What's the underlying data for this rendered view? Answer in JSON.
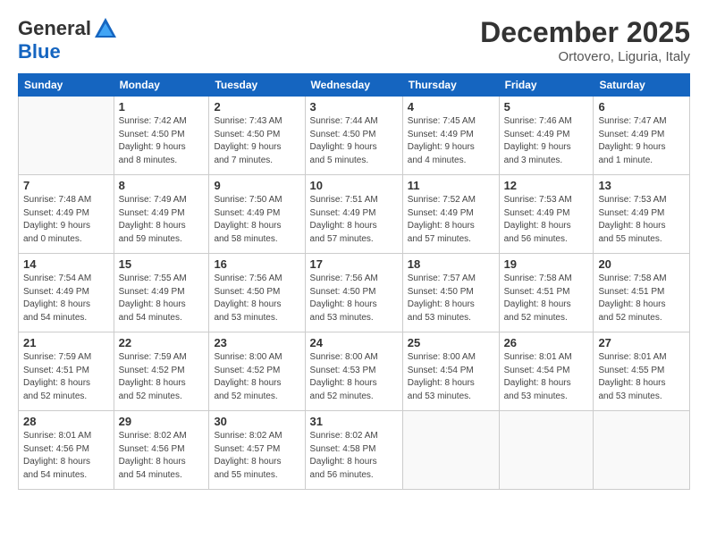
{
  "header": {
    "logo_general": "General",
    "logo_blue": "Blue",
    "month": "December 2025",
    "location": "Ortovero, Liguria, Italy"
  },
  "days_of_week": [
    "Sunday",
    "Monday",
    "Tuesday",
    "Wednesday",
    "Thursday",
    "Friday",
    "Saturday"
  ],
  "weeks": [
    [
      {
        "day": "",
        "info": ""
      },
      {
        "day": "1",
        "info": "Sunrise: 7:42 AM\nSunset: 4:50 PM\nDaylight: 9 hours\nand 8 minutes."
      },
      {
        "day": "2",
        "info": "Sunrise: 7:43 AM\nSunset: 4:50 PM\nDaylight: 9 hours\nand 7 minutes."
      },
      {
        "day": "3",
        "info": "Sunrise: 7:44 AM\nSunset: 4:50 PM\nDaylight: 9 hours\nand 5 minutes."
      },
      {
        "day": "4",
        "info": "Sunrise: 7:45 AM\nSunset: 4:49 PM\nDaylight: 9 hours\nand 4 minutes."
      },
      {
        "day": "5",
        "info": "Sunrise: 7:46 AM\nSunset: 4:49 PM\nDaylight: 9 hours\nand 3 minutes."
      },
      {
        "day": "6",
        "info": "Sunrise: 7:47 AM\nSunset: 4:49 PM\nDaylight: 9 hours\nand 1 minute."
      }
    ],
    [
      {
        "day": "7",
        "info": "Sunrise: 7:48 AM\nSunset: 4:49 PM\nDaylight: 9 hours\nand 0 minutes."
      },
      {
        "day": "8",
        "info": "Sunrise: 7:49 AM\nSunset: 4:49 PM\nDaylight: 8 hours\nand 59 minutes."
      },
      {
        "day": "9",
        "info": "Sunrise: 7:50 AM\nSunset: 4:49 PM\nDaylight: 8 hours\nand 58 minutes."
      },
      {
        "day": "10",
        "info": "Sunrise: 7:51 AM\nSunset: 4:49 PM\nDaylight: 8 hours\nand 57 minutes."
      },
      {
        "day": "11",
        "info": "Sunrise: 7:52 AM\nSunset: 4:49 PM\nDaylight: 8 hours\nand 57 minutes."
      },
      {
        "day": "12",
        "info": "Sunrise: 7:53 AM\nSunset: 4:49 PM\nDaylight: 8 hours\nand 56 minutes."
      },
      {
        "day": "13",
        "info": "Sunrise: 7:53 AM\nSunset: 4:49 PM\nDaylight: 8 hours\nand 55 minutes."
      }
    ],
    [
      {
        "day": "14",
        "info": "Sunrise: 7:54 AM\nSunset: 4:49 PM\nDaylight: 8 hours\nand 54 minutes."
      },
      {
        "day": "15",
        "info": "Sunrise: 7:55 AM\nSunset: 4:49 PM\nDaylight: 8 hours\nand 54 minutes."
      },
      {
        "day": "16",
        "info": "Sunrise: 7:56 AM\nSunset: 4:50 PM\nDaylight: 8 hours\nand 53 minutes."
      },
      {
        "day": "17",
        "info": "Sunrise: 7:56 AM\nSunset: 4:50 PM\nDaylight: 8 hours\nand 53 minutes."
      },
      {
        "day": "18",
        "info": "Sunrise: 7:57 AM\nSunset: 4:50 PM\nDaylight: 8 hours\nand 53 minutes."
      },
      {
        "day": "19",
        "info": "Sunrise: 7:58 AM\nSunset: 4:51 PM\nDaylight: 8 hours\nand 52 minutes."
      },
      {
        "day": "20",
        "info": "Sunrise: 7:58 AM\nSunset: 4:51 PM\nDaylight: 8 hours\nand 52 minutes."
      }
    ],
    [
      {
        "day": "21",
        "info": "Sunrise: 7:59 AM\nSunset: 4:51 PM\nDaylight: 8 hours\nand 52 minutes."
      },
      {
        "day": "22",
        "info": "Sunrise: 7:59 AM\nSunset: 4:52 PM\nDaylight: 8 hours\nand 52 minutes."
      },
      {
        "day": "23",
        "info": "Sunrise: 8:00 AM\nSunset: 4:52 PM\nDaylight: 8 hours\nand 52 minutes."
      },
      {
        "day": "24",
        "info": "Sunrise: 8:00 AM\nSunset: 4:53 PM\nDaylight: 8 hours\nand 52 minutes."
      },
      {
        "day": "25",
        "info": "Sunrise: 8:00 AM\nSunset: 4:54 PM\nDaylight: 8 hours\nand 53 minutes."
      },
      {
        "day": "26",
        "info": "Sunrise: 8:01 AM\nSunset: 4:54 PM\nDaylight: 8 hours\nand 53 minutes."
      },
      {
        "day": "27",
        "info": "Sunrise: 8:01 AM\nSunset: 4:55 PM\nDaylight: 8 hours\nand 53 minutes."
      }
    ],
    [
      {
        "day": "28",
        "info": "Sunrise: 8:01 AM\nSunset: 4:56 PM\nDaylight: 8 hours\nand 54 minutes."
      },
      {
        "day": "29",
        "info": "Sunrise: 8:02 AM\nSunset: 4:56 PM\nDaylight: 8 hours\nand 54 minutes."
      },
      {
        "day": "30",
        "info": "Sunrise: 8:02 AM\nSunset: 4:57 PM\nDaylight: 8 hours\nand 55 minutes."
      },
      {
        "day": "31",
        "info": "Sunrise: 8:02 AM\nSunset: 4:58 PM\nDaylight: 8 hours\nand 56 minutes."
      },
      {
        "day": "",
        "info": ""
      },
      {
        "day": "",
        "info": ""
      },
      {
        "day": "",
        "info": ""
      }
    ]
  ]
}
